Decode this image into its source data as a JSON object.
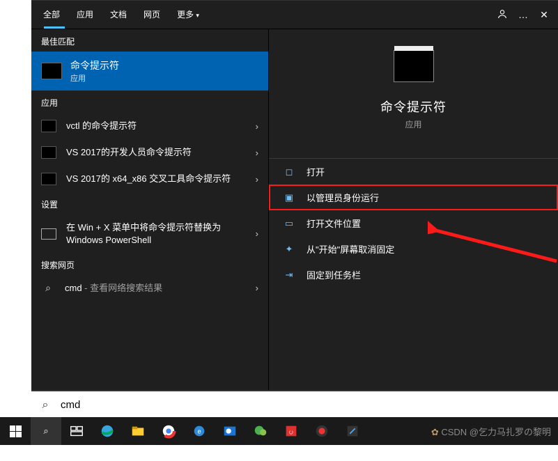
{
  "tabs": {
    "all": "全部",
    "apps": "应用",
    "docs": "文档",
    "web": "网页",
    "more": "更多"
  },
  "header_icons": {
    "feedback": "feedback-icon",
    "more": "…",
    "close": "✕"
  },
  "sections": {
    "best": "最佳匹配",
    "apps": "应用",
    "settings": "设置",
    "web": "搜索网页"
  },
  "best": {
    "title": "命令提示符",
    "sub": "应用"
  },
  "apps": [
    {
      "label": "vctl 的命令提示符"
    },
    {
      "label": "VS 2017的开发人员命令提示符"
    },
    {
      "label": "VS 2017的 x64_x86 交叉工具命令提示符"
    }
  ],
  "settings": [
    {
      "label": "在 Win + X 菜单中将命令提示符替换为 Windows PowerShell"
    }
  ],
  "web": [
    {
      "prefix": "cmd",
      "suffix": " - 查看网络搜索结果"
    }
  ],
  "preview": {
    "title": "命令提示符",
    "sub": "应用"
  },
  "actions": [
    {
      "label": "打开"
    },
    {
      "label": "以管理员身份运行",
      "hl": true
    },
    {
      "label": "打开文件位置"
    },
    {
      "label": "从\"开始\"屏幕取消固定"
    },
    {
      "label": "固定到任务栏"
    }
  ],
  "search": {
    "value": "cmd"
  },
  "watermark": "CSDN @乞力马扎罗の黎明"
}
